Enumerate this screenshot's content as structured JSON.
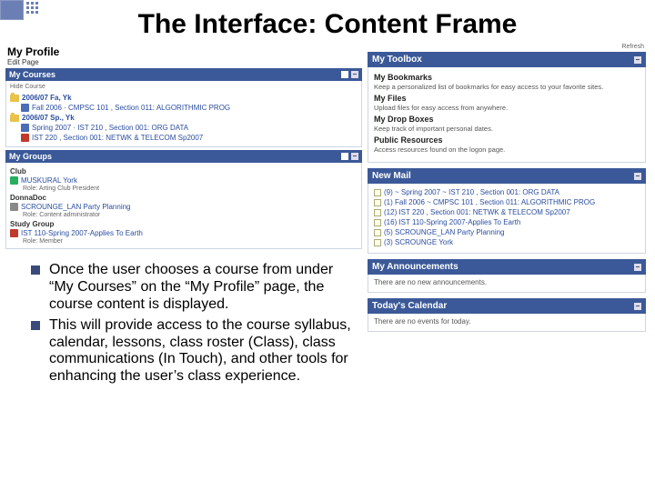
{
  "title": "The Interface: Content Frame",
  "profile": {
    "heading": "My Profile",
    "edit": "Edit Page"
  },
  "courses": {
    "bar": "My Courses",
    "hint": "Hide Course",
    "sem1": "2006/07 Fa, Yk",
    "sem1_items": [
      "Fall 2006 · CMPSC 101 , Section 011: ALGORITHMIC PROG",
      "2006/07 Sp., Yk",
      "Spring 2007 · IST 210 , Section 001: ORG DATA",
      "IST 220 , Section 001: NETWK & TELECOM Sp2007"
    ]
  },
  "groups": {
    "bar": "My Groups",
    "g1": "Club",
    "g1a": "MUSKURAL York",
    "g1a_sub": "Role: Arting Club President",
    "g2": "DonnaDoc",
    "g2a": "SCROUNGE_LAN Party Planning",
    "g2a_sub": "Role: Content administrator",
    "g3": "Study Group",
    "g3a": "IST 110-Spring 2007-Applies To Earth",
    "g3a_sub": "Role: Member"
  },
  "bullets": [
    "Once the user chooses a course from under “My Courses” on the “My Profile” page, the course content is displayed.",
    "This will provide access to the course syllabus, calendar, lessons, class roster (Class), class communications (In Touch), and other tools for enhancing the user’s class experience."
  ],
  "right": {
    "refresh": "Refresh",
    "toolbox": {
      "bar": "My Toolbox",
      "s1": "My Bookmarks",
      "s1d": "Keep a personalized list of bookmarks for easy access to your favorite sites.",
      "s2": "My Files",
      "s2d": "Upload files for easy access from anywhere.",
      "s3": "My Drop Boxes",
      "s3d": "Keep track of important personal dates.",
      "s4": "Public Resources",
      "s4d": "Access resources found on the logon page."
    },
    "mail": {
      "bar": "New Mail",
      "items": [
        "(9) ~ Spring 2007 ~ IST 210 , Section 001: ORG DATA",
        "(1) Fall 2006 ~ CMPSC 101 , Section 011: ALGORITHMIC PROG",
        "(12) IST 220 , Section 001: NETWK & TELECOM Sp2007",
        "(16) IST 110-Spring 2007-Applies To Earth",
        "(5) SCROUNGE_LAN Party Planning",
        "(3) SCROUNGE York"
      ]
    },
    "ann": {
      "bar": "My Announcements",
      "body": "There are no new announcements."
    },
    "cal": {
      "bar": "Today's Calendar",
      "body": "There are no events for today."
    }
  }
}
